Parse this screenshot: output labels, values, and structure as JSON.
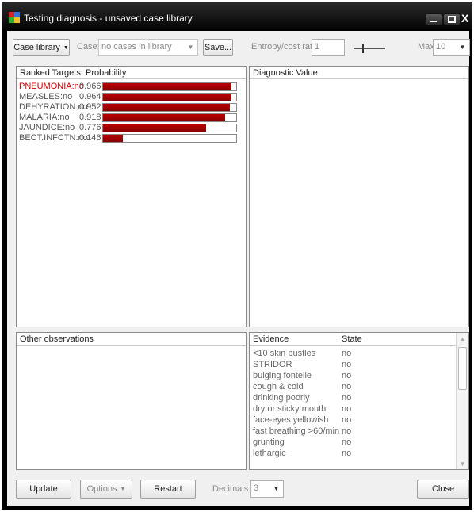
{
  "window": {
    "title": "Testing diagnosis - unsaved case library",
    "close_glyph": "X"
  },
  "toolbar": {
    "case_library_label": "Case library",
    "case_label": "Case:",
    "case_value": "no cases in library",
    "save_label": "Save...",
    "entropy_label": "Entropy/cost ratio:",
    "entropy_value": "1",
    "max_label": "Max:",
    "max_value": "10"
  },
  "targets": {
    "col_targets": "Ranked Targets",
    "col_probability": "Probability",
    "rows": [
      {
        "name": "PNEUMONIA:no",
        "prob_text": "0.966",
        "prob": 0.966,
        "color": "#d00000"
      },
      {
        "name": "MEASLES:no",
        "prob_text": "0.964",
        "prob": 0.964,
        "color": "#555555"
      },
      {
        "name": "DEHYRATION:no",
        "prob_text": "0.952",
        "prob": 0.952,
        "color": "#555555"
      },
      {
        "name": "MALARIA:no",
        "prob_text": "0.918",
        "prob": 0.918,
        "color": "#555555"
      },
      {
        "name": "JAUNDICE:no",
        "prob_text": "0.776",
        "prob": 0.776,
        "color": "#555555"
      },
      {
        "name": "BECT.INFCTN:no",
        "prob_text": "0.146",
        "prob": 0.146,
        "color": "#555555"
      }
    ]
  },
  "diagnostic": {
    "header": "Diagnostic Value"
  },
  "observations": {
    "header": "Other observations"
  },
  "evidence": {
    "col_evidence": "Evidence",
    "col_state": "State",
    "rows": [
      {
        "evidence": "<10 skin pustles",
        "state": "no"
      },
      {
        "evidence": "STRIDOR",
        "state": "no"
      },
      {
        "evidence": "bulging fontelle",
        "state": "no"
      },
      {
        "evidence": "cough & cold",
        "state": "no"
      },
      {
        "evidence": "drinking poorly",
        "state": "no"
      },
      {
        "evidence": "dry or sticky mouth",
        "state": "no"
      },
      {
        "evidence": "face-eyes yellowish",
        "state": "no"
      },
      {
        "evidence": "fast breathing >60/min",
        "state": "no"
      },
      {
        "evidence": "grunting",
        "state": "no"
      },
      {
        "evidence": "lethargic",
        "state": "no"
      }
    ]
  },
  "footer": {
    "update_label": "Update",
    "options_label": "Options",
    "restart_label": "Restart",
    "decimals_label": "Decimals:",
    "decimals_value": "3",
    "close_label": "Close"
  },
  "colors": {
    "bar_fill": "#a00000",
    "highlight_target": "#d00000"
  }
}
